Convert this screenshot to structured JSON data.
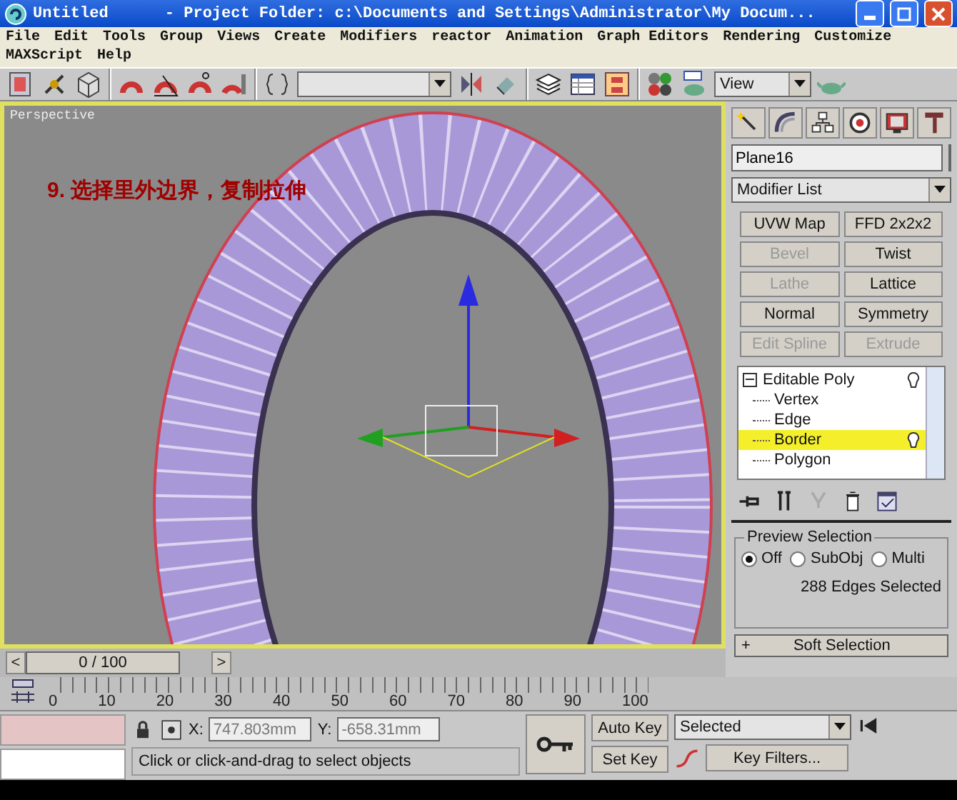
{
  "window": {
    "title": "Untitled      - Project Folder: c:\\Documents and Settings\\Administrator\\My Docum..."
  },
  "menu": [
    "File",
    "Edit",
    "Tools",
    "Group",
    "Views",
    "Create",
    "Modifiers",
    "reactor",
    "Animation",
    "Graph Editors",
    "Rendering",
    "Customize",
    "MAXScript",
    "Help"
  ],
  "toolbar": {
    "view_dropdown": "View"
  },
  "viewport": {
    "label": "Perspective",
    "caption": "9. 选择里外边界，复制拉伸"
  },
  "command_panel": {
    "object_name": "Plane16",
    "modifier_list": "Modifier List",
    "modifier_buttons": [
      {
        "label": "UVW Map",
        "disabled": false
      },
      {
        "label": "FFD 2x2x2",
        "disabled": false
      },
      {
        "label": "Bevel",
        "disabled": true
      },
      {
        "label": "Twist",
        "disabled": false
      },
      {
        "label": "Lathe",
        "disabled": true
      },
      {
        "label": "Lattice",
        "disabled": false
      },
      {
        "label": "Normal",
        "disabled": false
      },
      {
        "label": "Symmetry",
        "disabled": false
      },
      {
        "label": "Edit Spline",
        "disabled": true
      },
      {
        "label": "Extrude",
        "disabled": true
      }
    ],
    "stack": [
      {
        "label": "Editable Poly",
        "expanded": true,
        "selected": false,
        "children": [
          {
            "label": "Vertex",
            "selected": false
          },
          {
            "label": "Edge",
            "selected": false
          },
          {
            "label": "Border",
            "selected": true
          },
          {
            "label": "Polygon",
            "selected": false
          }
        ]
      }
    ],
    "preview_selection": {
      "title": "Preview Selection",
      "options": [
        {
          "label": "Off",
          "selected": true
        },
        {
          "label": "SubObj",
          "selected": false
        },
        {
          "label": "Multi",
          "selected": false
        }
      ],
      "status": "288 Edges Selected"
    },
    "rollout": {
      "sign": "+",
      "label": "Soft Selection"
    }
  },
  "time_slider": {
    "prev": "<",
    "label": "0 / 100",
    "next": ">",
    "level": 0
  },
  "track_ticks": [
    "0",
    "10",
    "20",
    "30",
    "40",
    "50",
    "60",
    "70",
    "80",
    "90",
    "100"
  ],
  "status": {
    "x_label": "X:",
    "x": "747.803mm",
    "y_label": "Y:",
    "y": "-658.31mm",
    "prompt": "Click or click-and-drag to select objects",
    "auto_key": "Auto Key",
    "set_key": "Set Key",
    "key_mode": "Selected",
    "key_filters": "Key Filters..."
  }
}
